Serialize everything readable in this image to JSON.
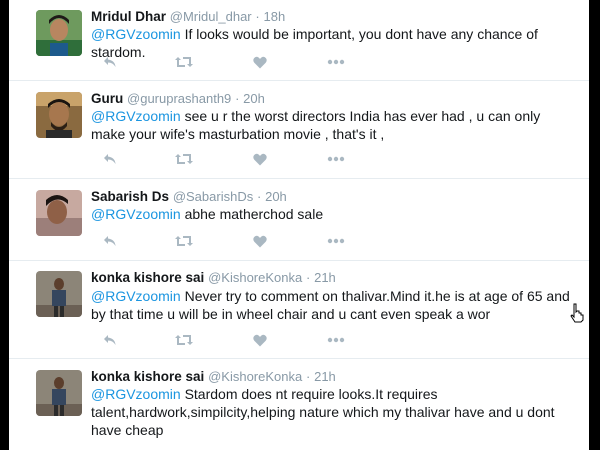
{
  "tweets": [
    {
      "name": "Mridul Dhar",
      "handle": "@Mridul_dhar",
      "separator": "·",
      "time": "18h",
      "mention": "@RGVzoomin",
      "text": " If looks would be important, you dont have any chance of stardom."
    },
    {
      "name": "Guru",
      "handle": "@guruprashanth9",
      "separator": "·",
      "time": "20h",
      "mention": "@RGVzoomin",
      "text": " see u r the worst directors India has ever had , u can only make your wife's masturbation movie , that's it ,"
    },
    {
      "name": "Sabarish Ds",
      "handle": "@SabarishDs",
      "separator": "·",
      "time": "20h",
      "mention": "@RGVzoomin",
      "text": " abhe matherchod sale"
    },
    {
      "name": "konka kishore sai",
      "handle": "@KishoreKonka",
      "separator": "·",
      "time": "21h",
      "mention": "@RGVzoomin",
      "text": " Never try to comment on thalivar.Mind it.he is at age of 65 and by that time u will be in wheel chair and u cant even speak a wor"
    },
    {
      "name": "konka kishore sai",
      "handle": "@KishoreKonka",
      "separator": "·",
      "time": "21h",
      "mention": "@RGVzoomin",
      "text": " Stardom does nt require looks.It requires talent,hardwork,simpilcity,helping nature which my thalivar have and u dont have cheap"
    }
  ],
  "icons": {
    "reply": "reply-icon",
    "retweet": "retweet-icon",
    "like": "heart-icon",
    "more": "more-icon",
    "cursor": "hand-pointer-icon"
  },
  "colors": {
    "name": "#14171a",
    "meta": "#8899a6",
    "mention": "#1b95e0",
    "action_icon": "#aab8c2",
    "divider": "#e6ecf0",
    "frame": "#000000"
  }
}
